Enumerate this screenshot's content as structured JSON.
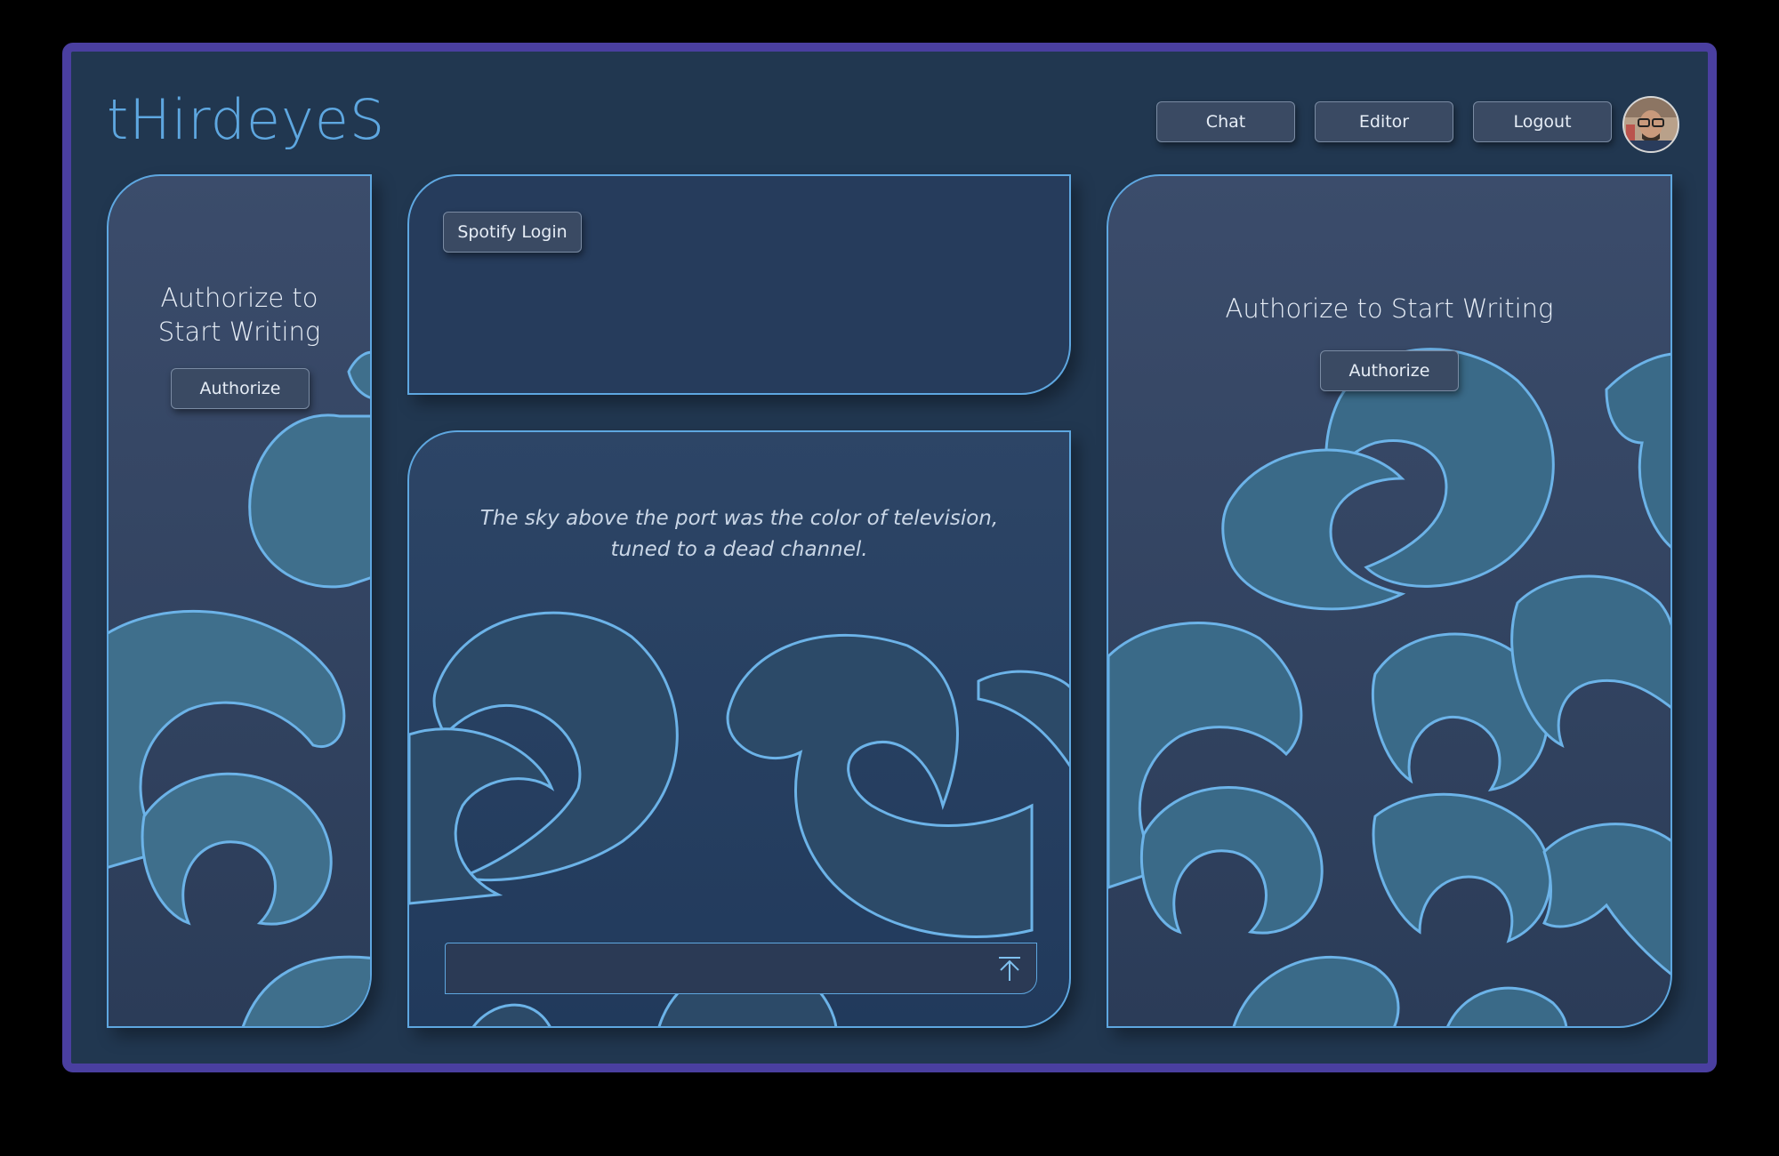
{
  "app": {
    "logo_text": "tHirdeyeS"
  },
  "nav": {
    "chat_label": "Chat",
    "editor_label": "Editor",
    "logout_label": "Logout"
  },
  "left_panel": {
    "title": "Authorize to Start Writing",
    "button_label": "Authorize"
  },
  "spotify_panel": {
    "button_label": "Spotify Login"
  },
  "editor_panel": {
    "quote": "The sky above the port was the color of television, tuned to a dead channel.",
    "input_value": "",
    "send_icon": "upload-arrow-icon"
  },
  "right_panel": {
    "title": "Authorize to Start Writing",
    "button_label": "Authorize"
  },
  "colors": {
    "frame_border": "#4a3fa0",
    "background": "#213750",
    "accent": "#5ea7e0",
    "button_bg": "#3a4a63"
  }
}
